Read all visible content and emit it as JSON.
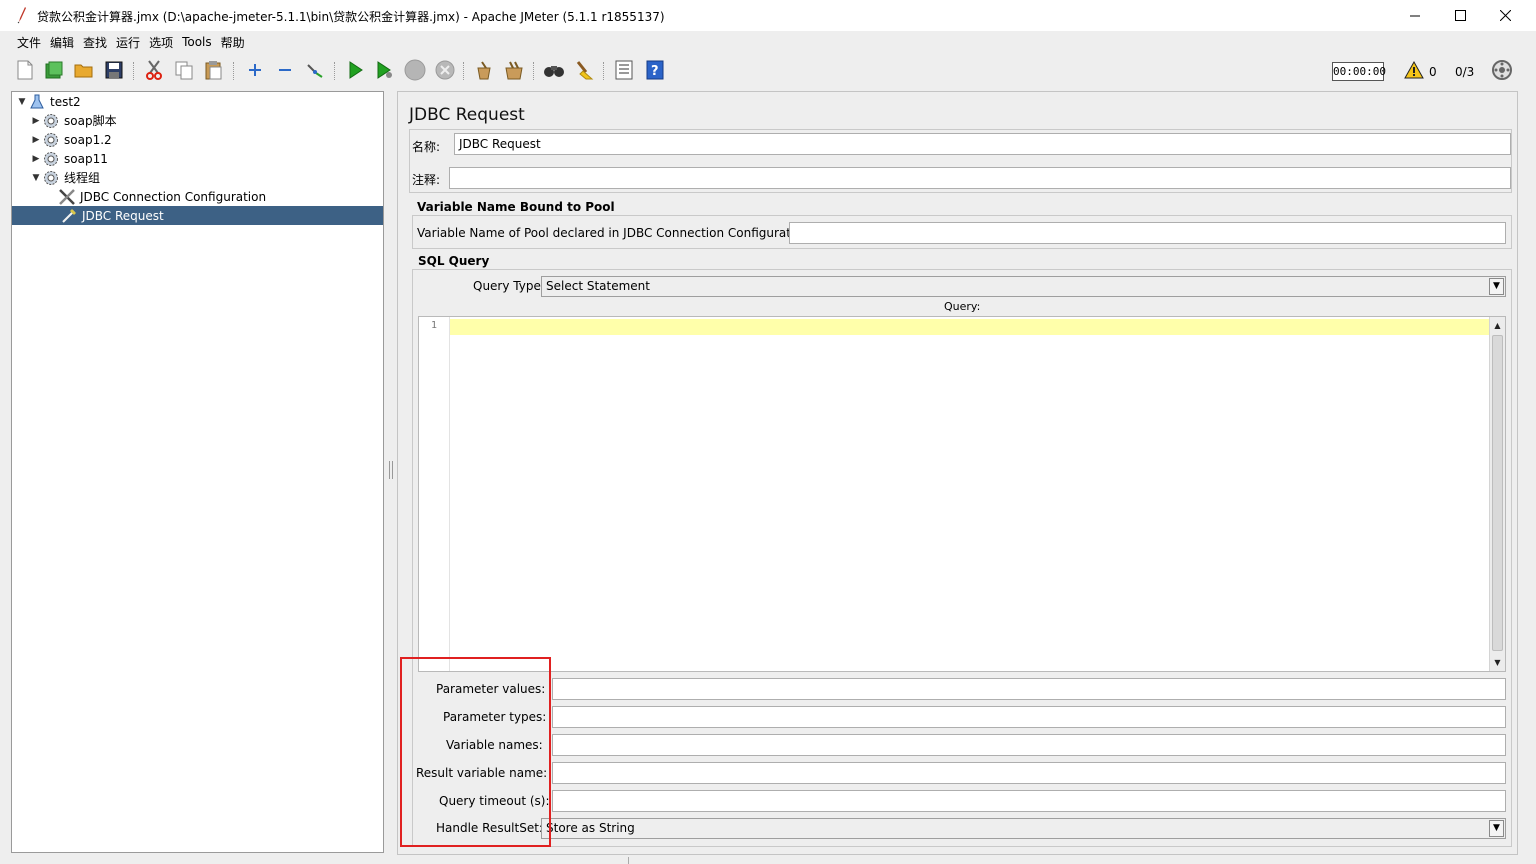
{
  "window": {
    "title": "贷款公积金计算器.jmx (D:\\apache-jmeter-5.1.1\\bin\\贷款公积金计算器.jmx) - Apache JMeter (5.1.1 r1855137)",
    "minimize": "—",
    "maximize": "☐",
    "close": "✕"
  },
  "menu": {
    "items": [
      "文件",
      "编辑",
      "查找",
      "运行",
      "选项",
      "Tools",
      "帮助"
    ]
  },
  "toolbar": {
    "timer": "00:00:00",
    "warning_count": "0",
    "thread_count": "0/3",
    "icons": [
      "new-icon",
      "templates-icon",
      "open-icon",
      "save-icon",
      "cut-icon",
      "copy-icon",
      "paste-icon",
      "expand-icon",
      "collapse-icon",
      "toggle-icon",
      "start-icon",
      "start-no-pause-icon",
      "stop-icon",
      "shutdown-icon",
      "clear-icon",
      "clear-all-icon",
      "search-icon",
      "reset-search-icon",
      "function-helper-icon",
      "help-icon",
      "remote-icon"
    ]
  },
  "tree": {
    "root": "test2",
    "items": [
      {
        "label": "soap脚本"
      },
      {
        "label": "soap1.2"
      },
      {
        "label": "soap11"
      },
      {
        "label": "线程组"
      },
      {
        "label": "JDBC Connection Configuration"
      },
      {
        "label": "JDBC Request"
      }
    ]
  },
  "panel": {
    "title": "JDBC Request",
    "name_label": "名称:",
    "name_value": "JDBC Request",
    "comment_label": "注释:",
    "comment_value": "",
    "pool_section": "Variable Name Bound to Pool",
    "pool_label": "Variable Name of Pool declared in JDBC Connection Configuration:",
    "pool_value": "",
    "sql_section": "SQL Query",
    "query_type_label": "Query Type:",
    "query_type_value": "Select Statement",
    "query_label": "Query:",
    "line_number": "1",
    "param_values_label": "Parameter values:",
    "param_types_label": "Parameter types:",
    "variable_names_label": "Variable names:",
    "result_var_label": "Result variable name:",
    "query_timeout_label": "Query timeout (s):",
    "handle_resultset_label": "Handle ResultSet:",
    "handle_resultset_value": "Store as String"
  },
  "colors": {
    "selection": "#3d6185",
    "current_line": "#ffffaa",
    "highlight_box": "#e02020"
  }
}
